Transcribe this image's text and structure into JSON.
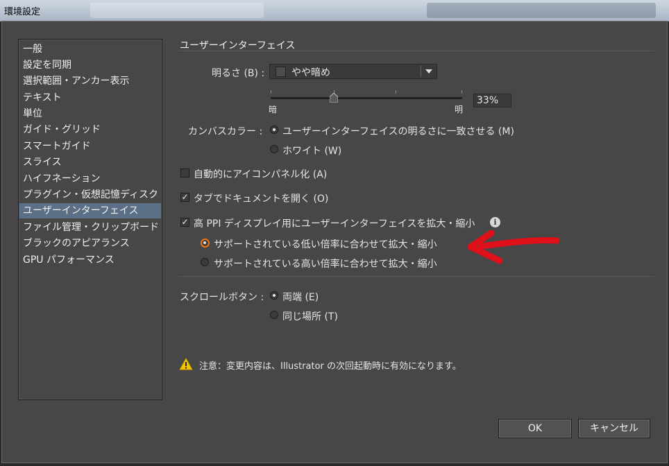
{
  "window": {
    "title": "環境設定"
  },
  "sidebar": {
    "items": [
      {
        "label": "一般"
      },
      {
        "label": "設定を同期"
      },
      {
        "label": "選択範囲・アンカー表示"
      },
      {
        "label": "テキスト"
      },
      {
        "label": "単位"
      },
      {
        "label": "ガイド・グリッド"
      },
      {
        "label": "スマートガイド"
      },
      {
        "label": "スライス"
      },
      {
        "label": "ハイフネーション"
      },
      {
        "label": "プラグイン・仮想記憶ディスク"
      },
      {
        "label": "ユーザーインターフェイス",
        "selected": true
      },
      {
        "label": "ファイル管理・クリップボード"
      },
      {
        "label": "ブラックのアピアランス"
      },
      {
        "label": "GPU パフォーマンス"
      }
    ]
  },
  "main": {
    "section_title": "ユーザーインターフェイス",
    "brightness": {
      "label": "明るさ (B) :",
      "selected": "やや暗め",
      "min_label": "暗",
      "max_label": "明",
      "value": "33%"
    },
    "canvas_color": {
      "label": "カンバスカラー :",
      "options": [
        {
          "label": "ユーザーインターフェイスの明るさに一致させる (M)",
          "checked": true
        },
        {
          "label": "ホワイト (W)",
          "checked": false
        }
      ]
    },
    "checkboxes": [
      {
        "label": "自動的にアイコンパネル化 (A)",
        "checked": false
      },
      {
        "label": "タブでドキュメントを開く (O)",
        "checked": true
      },
      {
        "label": "高 PPI ディスプレイ用にユーザーインターフェイスを拡大・縮小",
        "checked": true
      }
    ],
    "scaling": {
      "options": [
        {
          "label": "サポートされている低い倍率に合わせて拡大・縮小",
          "checked": true
        },
        {
          "label": "サポートされている高い倍率に合わせて拡大・縮小",
          "checked": false
        }
      ]
    },
    "scroll_buttons": {
      "label": "スクロールボタン :",
      "options": [
        {
          "label": "両端 (E)",
          "checked": true
        },
        {
          "label": "同じ場所 (T)",
          "checked": false
        }
      ]
    },
    "note": "注意：変更内容は、Illustrator の次回起動時に有効になります。"
  },
  "buttons": {
    "ok": "OK",
    "cancel": "キャンセル"
  },
  "colors": {
    "accent_highlight": "#f07818",
    "annotation_arrow": "#e0101a",
    "selected_item": "#5b6f86"
  },
  "icons": [
    "info-icon",
    "warning-icon",
    "chevron-down-icon",
    "annotation-arrow"
  ]
}
